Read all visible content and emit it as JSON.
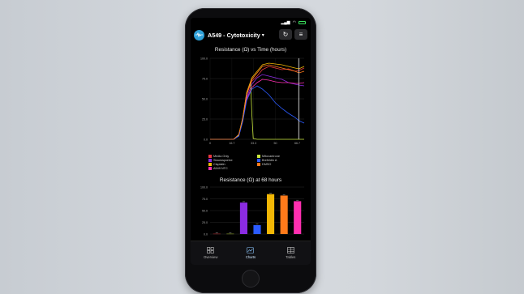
{
  "app": {
    "title": "A549 - Cytotoxicity",
    "logo_icon": "waveform-icon",
    "refresh_icon": "refresh-icon",
    "menu_icon": "hamburger-menu-icon"
  },
  "status_bar": {
    "signal": "signal-icon",
    "wifi": "wifi-icon",
    "battery": "battery-icon"
  },
  "chart_data": [
    {
      "type": "line",
      "title": "Resistance (Ω) vs Time (hours)",
      "xlabel": "",
      "ylabel": "",
      "x_ticks": [
        "0",
        "16.7",
        "33.3",
        "50",
        "66.7"
      ],
      "y_ticks": [
        "0.0",
        "25.0",
        "50.0",
        "75.0",
        "100.0"
      ],
      "xlim": [
        0,
        72
      ],
      "ylim": [
        0,
        100
      ],
      "grid": true,
      "marker_x": 68,
      "series": [
        {
          "name": "Media Only",
          "color": "#e8383d",
          "x": [
            0,
            10,
            18,
            22,
            25,
            28,
            32,
            36,
            40,
            45,
            50,
            55,
            60,
            65,
            68,
            72
          ],
          "y": [
            0,
            0,
            0,
            5,
            25,
            55,
            72,
            78,
            86,
            90,
            88,
            86,
            87,
            84,
            85,
            88
          ]
        },
        {
          "name": "Staurosporine",
          "color": "#8b2be2",
          "x": [
            0,
            10,
            18,
            22,
            25,
            28,
            32,
            36,
            40,
            45,
            50,
            55,
            60,
            65,
            68,
            72
          ],
          "y": [
            0,
            0,
            0,
            4,
            24,
            52,
            68,
            76,
            80,
            78,
            76,
            74,
            70,
            68,
            67,
            66
          ]
        },
        {
          "name": "Cisplatin",
          "color": "#f2b705",
          "x": [
            0,
            10,
            18,
            22,
            25,
            28,
            32,
            36,
            40,
            45,
            50,
            55,
            60,
            65,
            68,
            72
          ],
          "y": [
            0,
            0,
            0,
            6,
            27,
            58,
            76,
            84,
            92,
            94,
            93,
            92,
            90,
            88,
            87,
            90
          ]
        },
        {
          "name": "A549 NTC",
          "color": "#ff2fb0",
          "x": [
            0,
            10,
            18,
            22,
            25,
            28,
            32,
            36,
            40,
            45,
            50,
            55,
            60,
            65,
            68,
            72
          ],
          "y": [
            0,
            0,
            0,
            5,
            24,
            50,
            64,
            70,
            74,
            73,
            71,
            70,
            70,
            69,
            69,
            70
          ]
        },
        {
          "name": "Mitoxantrone",
          "color": "#c8e63c",
          "x": [
            0,
            10,
            18,
            22,
            25,
            28,
            31,
            32,
            33,
            36,
            40,
            50,
            60,
            68,
            72
          ],
          "y": [
            0,
            0,
            0,
            5,
            26,
            56,
            70,
            30,
            1,
            0,
            0,
            0,
            0,
            0,
            0
          ]
        },
        {
          "name": "Brefeldin A",
          "color": "#2b5bff",
          "x": [
            0,
            10,
            18,
            22,
            25,
            28,
            32,
            36,
            40,
            45,
            50,
            55,
            60,
            65,
            68,
            72
          ],
          "y": [
            0,
            0,
            0,
            4,
            22,
            48,
            62,
            66,
            62,
            55,
            45,
            38,
            32,
            27,
            23,
            20
          ]
        },
        {
          "name": "DMSO",
          "color": "#ff7a1a",
          "x": [
            0,
            10,
            18,
            22,
            25,
            28,
            32,
            36,
            40,
            45,
            50,
            55,
            60,
            65,
            68,
            72
          ],
          "y": [
            0,
            0,
            0,
            6,
            26,
            57,
            74,
            82,
            90,
            92,
            90,
            88,
            86,
            84,
            82,
            84
          ]
        }
      ]
    },
    {
      "type": "bar",
      "title": "Resistance (Ω) at 68 hours",
      "xlabel": "",
      "ylabel": "",
      "y_ticks": [
        "0.0",
        "25.0",
        "50.0",
        "75.0",
        "100.0"
      ],
      "ylim": [
        0,
        100
      ],
      "grid": true,
      "categories": [
        "Media Only",
        "Staurosporine",
        "Cisplatin",
        "A549 NTC",
        "Mitoxantrone",
        "Brefeldin A",
        "DMSO"
      ],
      "values": [
        0.5,
        0.5,
        67,
        19,
        85,
        82,
        70
      ],
      "colors": [
        "#e8383d",
        "#c8e63c",
        "#8b2be2",
        "#2b5bff",
        "#f2b705",
        "#ff7a1a",
        "#ff2fb0"
      ]
    }
  ],
  "legend": [
    {
      "label": "Media Only",
      "color": "#e8383d"
    },
    {
      "label": "Mitoxantrone",
      "color": "#c8e63c"
    },
    {
      "label": "Staurosporine",
      "color": "#8b2be2"
    },
    {
      "label": "Brefeldin A",
      "color": "#2b5bff"
    },
    {
      "label": "Cisplatin",
      "color": "#f2b705"
    },
    {
      "label": "DMSO",
      "color": "#ff7a1a"
    },
    {
      "label": "A549 NTC",
      "color": "#ff2fb0"
    }
  ],
  "tabs": [
    {
      "label": "Overview",
      "icon": "grid-icon",
      "active": false
    },
    {
      "label": "Charts",
      "icon": "chart-icon",
      "active": true
    },
    {
      "label": "Tables",
      "icon": "table-icon",
      "active": false
    }
  ]
}
